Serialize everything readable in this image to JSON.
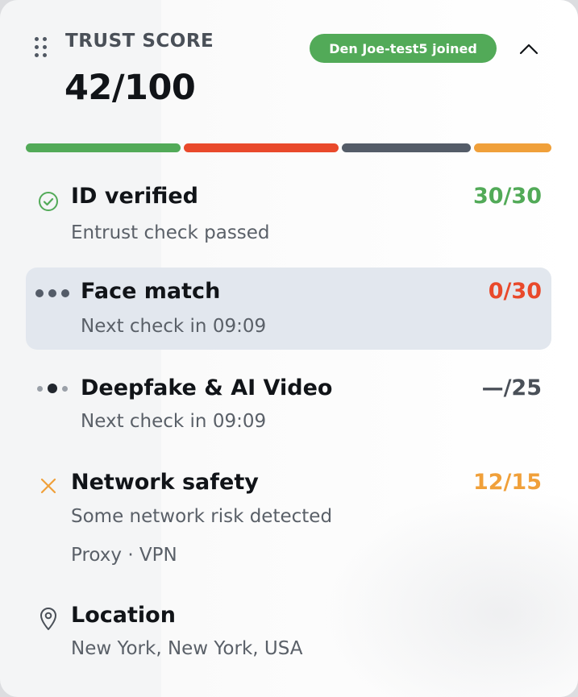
{
  "header": {
    "title": "TRUST SCORE",
    "score": "42/100",
    "badge": "Den Joe-test5 joined"
  },
  "score_bar": {
    "segments": [
      {
        "color": "#52aa58"
      },
      {
        "color": "#e9492b"
      },
      {
        "color": "#545c68"
      },
      {
        "color": "#f0a03a"
      }
    ]
  },
  "checks": [
    {
      "label": "ID verified",
      "value": "30/30",
      "detail": "Entrust check passed",
      "status_color": "#52aa58",
      "icon": "check-circle-icon"
    },
    {
      "label": "Face match",
      "value": "0/30",
      "detail": "Next check in 09:09",
      "status_color": "#e9492b",
      "icon": "loading-dots-icon"
    },
    {
      "label": "Deepfake & AI Video",
      "value": "—/25",
      "detail": "Next check in 09:09",
      "status_color": "#4a5058",
      "icon": "loading-dots-icon"
    },
    {
      "label": "Network safety",
      "value": "12/15",
      "detail": "Some network risk detected",
      "detail2": "Proxy · VPN",
      "status_color": "#f0a03a",
      "icon": "x-icon"
    },
    {
      "label": "Location",
      "detail": "New York, New York, USA",
      "icon": "location-pin-icon"
    }
  ]
}
